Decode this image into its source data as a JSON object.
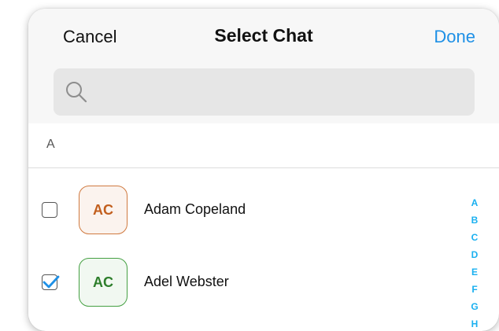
{
  "header": {
    "cancel_label": "Cancel",
    "title": "Select Chat",
    "done_label": "Done"
  },
  "search": {
    "placeholder": "",
    "value": "",
    "icon": "search-icon"
  },
  "section": {
    "letter": "A"
  },
  "contacts": [
    {
      "initials": "AC",
      "name": "Adam Copeland",
      "checked": false,
      "avatar_color": "#d07a40"
    },
    {
      "initials": "AC",
      "name": "Adel Webster",
      "checked": true,
      "avatar_color": "#45a043"
    }
  ],
  "index_letters": [
    "A",
    "B",
    "C",
    "D",
    "E",
    "F",
    "G",
    "H"
  ],
  "colors": {
    "accent": "#1e90e6",
    "index": "#1ab0f0",
    "check": "#1e90e6"
  }
}
